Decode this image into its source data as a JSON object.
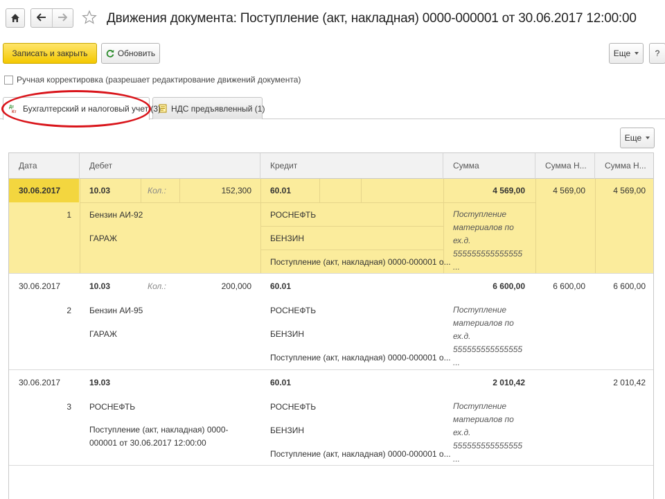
{
  "window": {
    "title": "Движения документа: Поступление (акт, накладная) 0000-000001 от 30.06.2017 12:00:00",
    "icons": {
      "home": "home-icon",
      "back": "arrow-left-icon",
      "forward": "arrow-right-icon",
      "favorite": "star-icon"
    }
  },
  "toolbar": {
    "save_close_label": "Записать и закрыть",
    "refresh_label": "Обновить",
    "more_label": "Еще",
    "help_label": "?"
  },
  "manual_correction": {
    "label": "Ручная корректировка (разрешает редактирование движений документа)",
    "checked": false
  },
  "tabs": [
    {
      "label": "Бухгалтерский и налоговый учет (3)",
      "active": true,
      "icon": "dt-kt-icon"
    },
    {
      "label": "НДС предъявленный (1)",
      "active": false,
      "icon": "document-icon"
    }
  ],
  "grid": {
    "more_label": "Еще",
    "columns": [
      "Дата",
      "Дебет",
      "Кредит",
      "Сумма",
      "Сумма Н...",
      "Сумма Н..."
    ],
    "rows": [
      {
        "date": "30.06.2017",
        "num": "1",
        "debit_account": "10.03",
        "qty_label": "Кол.:",
        "qty": "152,300",
        "debit_sub1": "Бензин АИ-92",
        "debit_sub2": "ГАРАЖ",
        "credit_account": "60.01",
        "credit_sub1": "РОСНЕФТЬ",
        "credit_sub2": "БЕНЗИН",
        "credit_sub3": "Поступление (акт, накладная) 0000-000001 о...",
        "amount": "4 569,00",
        "content": "Поступление материалов по ех.д. 555555555555555 ...",
        "amount_nu_dt": "4 569,00",
        "amount_nu_kt": "4 569,00"
      },
      {
        "date": "30.06.2017",
        "num": "2",
        "debit_account": "10.03",
        "qty_label": "Кол.:",
        "qty": "200,000",
        "debit_sub1": "Бензин АИ-95",
        "debit_sub2": "ГАРАЖ",
        "credit_account": "60.01",
        "credit_sub1": "РОСНЕФТЬ",
        "credit_sub2": "БЕНЗИН",
        "credit_sub3": "Поступление (акт, накладная) 0000-000001 о...",
        "amount": "6 600,00",
        "content": "Поступление материалов по ех.д. 555555555555555 ...",
        "amount_nu_dt": "6 600,00",
        "amount_nu_kt": "6 600,00"
      },
      {
        "date": "30.06.2017",
        "num": "3",
        "debit_account": "19.03",
        "debit_sub1": "РОСНЕФТЬ",
        "debit_sub2": "Поступление (акт, накладная) 0000-000001 от 30.06.2017 12:00:00",
        "credit_account": "60.01",
        "credit_sub1": "РОСНЕФТЬ",
        "credit_sub2": "БЕНЗИН",
        "credit_sub3": "Поступление (акт, накладная) 0000-000001 о...",
        "amount": "2 010,42",
        "content": "Поступление материалов по ех.д. 555555555555555 ...",
        "amount_nu_dt": "",
        "amount_nu_kt": "2 010,42"
      }
    ]
  },
  "colors": {
    "accent_yellow": "#f4c800",
    "selected_row": "#fbec9c",
    "highlight_circle": "#d9151b"
  }
}
